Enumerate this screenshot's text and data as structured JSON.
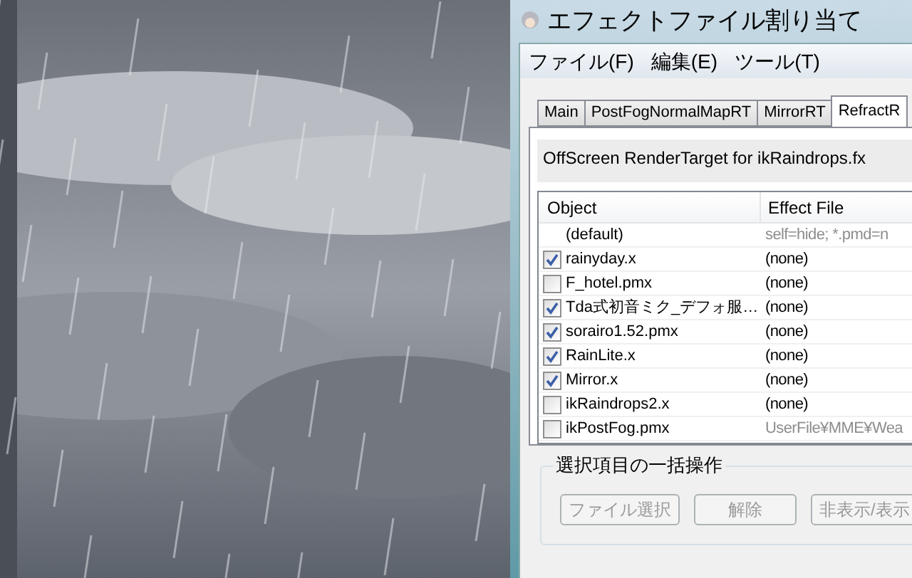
{
  "window": {
    "title": "エフェクトファイル割り当て"
  },
  "menu": [
    "ファイル(F)",
    "編集(E)",
    "ツール(T)"
  ],
  "tabs": [
    {
      "label": "Main",
      "selected": false
    },
    {
      "label": "PostFogNormalMapRT",
      "selected": false
    },
    {
      "label": "MirrorRT",
      "selected": false
    },
    {
      "label": "RefractR",
      "selected": true
    }
  ],
  "description": "OffScreen RenderTarget for ikRaindrops.fx",
  "table": {
    "columns": [
      "Object",
      "Effect File"
    ],
    "rows": [
      {
        "kind": "default",
        "object": "(default)",
        "effect": "self=hide; *.pmd=n",
        "dim": true
      },
      {
        "kind": "check",
        "checked": true,
        "object": "rainyday.x",
        "effect": "(none)",
        "dim": false
      },
      {
        "kind": "check",
        "checked": false,
        "object": "F_hotel.pmx",
        "effect": "(none)",
        "dim": false
      },
      {
        "kind": "check",
        "checked": true,
        "object": "Tda式初音ミク_デフォ服…",
        "effect": "(none)",
        "dim": false
      },
      {
        "kind": "check",
        "checked": true,
        "object": "sorairo1.52.pmx",
        "effect": "(none)",
        "dim": false
      },
      {
        "kind": "check",
        "checked": true,
        "object": "RainLite.x",
        "effect": "(none)",
        "dim": false
      },
      {
        "kind": "check",
        "checked": true,
        "object": "Mirror.x",
        "effect": "(none)",
        "dim": false
      },
      {
        "kind": "check",
        "checked": false,
        "object": "ikRaindrops2.x",
        "effect": "(none)",
        "dim": false
      },
      {
        "kind": "check",
        "checked": false,
        "object": "ikPostFog.pmx",
        "effect": "UserFile¥MME¥Wea",
        "dim": true
      }
    ]
  },
  "group": {
    "title": "選択項目の一括操作",
    "buttons": [
      {
        "label": "ファイル選択",
        "disabled": true
      },
      {
        "label": "解除",
        "disabled": true
      },
      {
        "label": "非表示/表示",
        "disabled": true
      }
    ]
  }
}
